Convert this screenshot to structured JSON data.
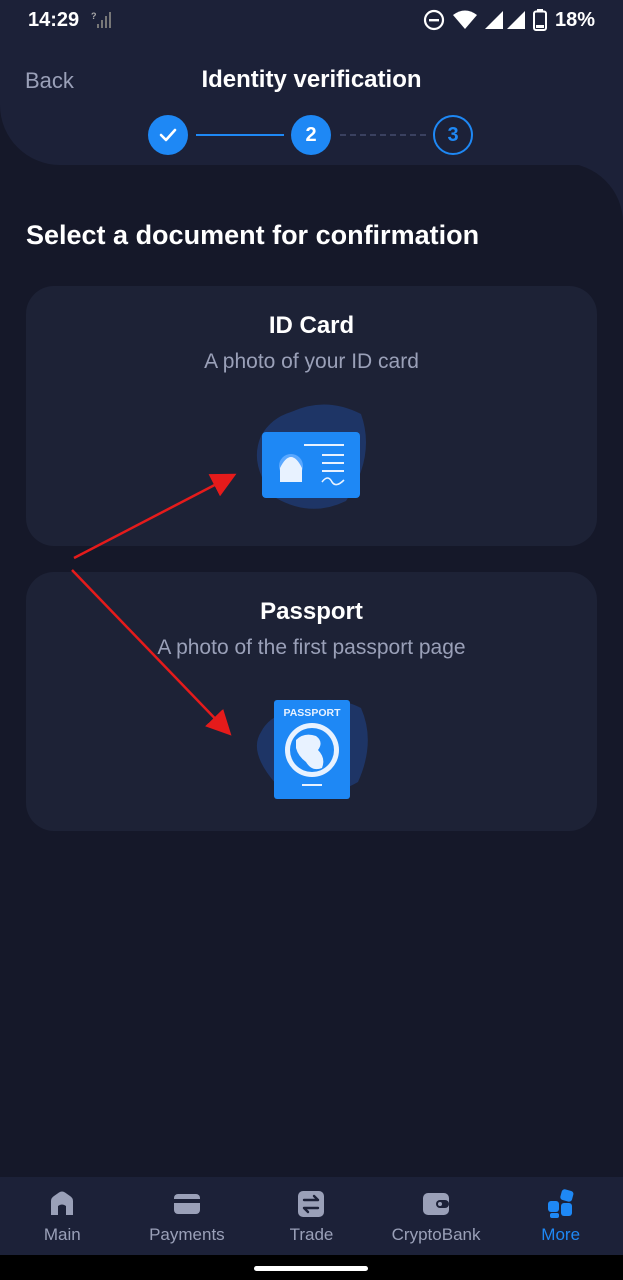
{
  "status_bar": {
    "time": "14:29",
    "battery": "18%",
    "icons": [
      "signal-question-icon",
      "do-not-disturb-icon",
      "wifi-icon",
      "cell-signal-icon",
      "battery-icon"
    ]
  },
  "header": {
    "back_label": "Back",
    "title": "Identity verification",
    "steps": [
      "",
      "2",
      "3"
    ]
  },
  "main": {
    "section_title": "Select a document for confirmation",
    "documents": [
      {
        "title": "ID Card",
        "subtitle": "A photo of your ID card",
        "icon": "id-card-icon"
      },
      {
        "title": "Passport",
        "subtitle": "A photo of the first passport page",
        "icon": "passport-icon",
        "icon_text": "PASSPORT"
      }
    ]
  },
  "tabbar": {
    "items": [
      {
        "label": "Main",
        "icon": "home-icon"
      },
      {
        "label": "Payments",
        "icon": "card-icon"
      },
      {
        "label": "Trade",
        "icon": "exchange-icon"
      },
      {
        "label": "CryptoBank",
        "icon": "wallet-icon"
      },
      {
        "label": "More",
        "icon": "grid-icon"
      }
    ],
    "selected": "More"
  },
  "colors": {
    "background": "#151829",
    "header": "#1c2138",
    "card": "#1d2236",
    "accent": "#1e88f5",
    "muted": "#9aa0b8",
    "annotation_arrow": "#e51b1b"
  }
}
